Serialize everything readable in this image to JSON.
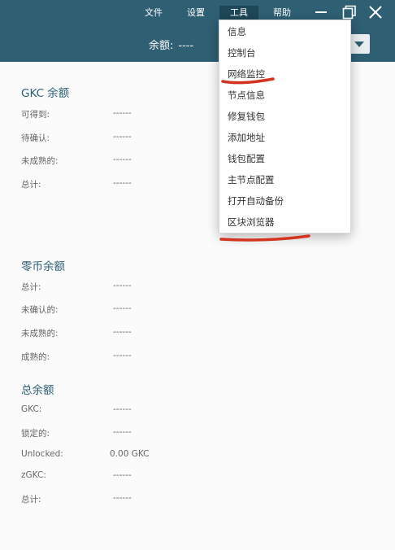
{
  "menu": {
    "file": "文件",
    "settings": "设置",
    "tools": "工具",
    "help": "帮助"
  },
  "header": {
    "balance_label": "余额:",
    "balance_value": "----"
  },
  "gkc_balance": {
    "title": "GKC 余额",
    "rows": [
      {
        "label": "可得到:",
        "value": "------"
      },
      {
        "label": "待确认:",
        "value": "------"
      },
      {
        "label": "未成熟的:",
        "value": "------"
      },
      {
        "label": "总计:",
        "value": "------"
      }
    ]
  },
  "zerocoin_balance": {
    "title": "零币余额",
    "rows": [
      {
        "label": "总计:",
        "value": "------"
      },
      {
        "label": "未确认的:",
        "value": "------"
      },
      {
        "label": "未成熟的:",
        "value": "------"
      },
      {
        "label": "成熟的:",
        "value": "------"
      }
    ]
  },
  "total_balance": {
    "title": "总余额",
    "rows": [
      {
        "label": "GKC:",
        "value": "------"
      },
      {
        "label": "锁定的:",
        "value": "------"
      },
      {
        "label": "Unlocked:",
        "value": "0.00 GKC"
      },
      {
        "label": "zGKC:",
        "value": "------"
      },
      {
        "label": "总计:",
        "value": "------"
      }
    ]
  },
  "tools_menu": {
    "items": [
      "信息",
      "控制台",
      "网络监控",
      "节点信息",
      "修复钱包",
      "添加地址",
      "钱包配置",
      "主节点配置",
      "打开自动备份",
      "区块浏览器"
    ]
  },
  "colors": {
    "header_bg": "#2e5f73",
    "annotation": "#d2341f",
    "section_title": "#2e5f73"
  }
}
